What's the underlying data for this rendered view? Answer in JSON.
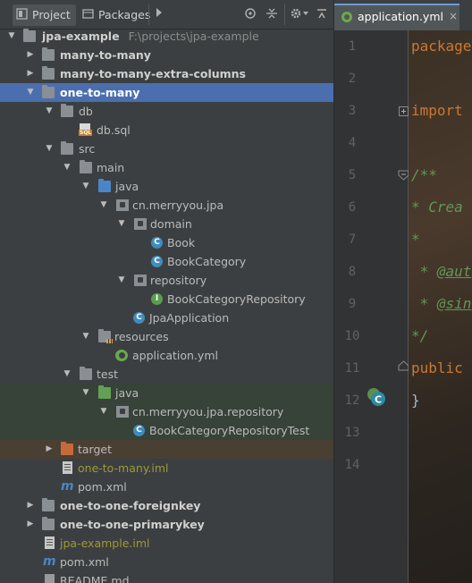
{
  "project_panel": {
    "tabs": [
      {
        "label": "Project",
        "active": true
      },
      {
        "label": "Packages",
        "active": false
      }
    ],
    "toolbar_icons": [
      "play-arrow-icon",
      "locate-target-icon",
      "collapse-all-icon",
      "settings-gear-icon",
      "hide-panel-icon"
    ]
  },
  "tree": {
    "rows": [
      {
        "label": "jpa-example",
        "hint": "F:\\projects\\jpa-example"
      },
      {
        "label": "many-to-many"
      },
      {
        "label": "many-to-many-extra-columns"
      },
      {
        "label": "one-to-many"
      },
      {
        "label": "db"
      },
      {
        "label": "db.sql"
      },
      {
        "label": "src"
      },
      {
        "label": "main"
      },
      {
        "label": "java"
      },
      {
        "label": "cn.merryyou.jpa"
      },
      {
        "label": "domain"
      },
      {
        "label": "Book"
      },
      {
        "label": "BookCategory"
      },
      {
        "label": "repository"
      },
      {
        "label": "BookCategoryRepository"
      },
      {
        "label": "JpaApplication"
      },
      {
        "label": "resources"
      },
      {
        "label": "application.yml"
      },
      {
        "label": "test"
      },
      {
        "label": "java"
      },
      {
        "label": "cn.merryyou.jpa.repository"
      },
      {
        "label": "BookCategoryRepositoryTest"
      },
      {
        "label": "target"
      },
      {
        "label": "one-to-many.iml"
      },
      {
        "label": "pom.xml"
      },
      {
        "label": "one-to-one-foreignkey"
      },
      {
        "label": "one-to-one-primarykey"
      },
      {
        "label": "jpa-example.iml"
      },
      {
        "label": "pom.xml"
      },
      {
        "label": "README.md"
      }
    ]
  },
  "editor": {
    "tab": {
      "label": "application.yml",
      "close": "×"
    },
    "line_numbers": [
      "1",
      "2",
      "3",
      "4",
      "5",
      "6",
      "7",
      "8",
      "9",
      "10",
      "11",
      "12",
      "13",
      "14"
    ],
    "code": {
      "line1": "package",
      "line3": "import",
      "line6": "/**",
      "line7": " * Crea",
      "line8": " *",
      "line9_prefix": " * ",
      "line9_tag": "@aut",
      "line10_prefix": " * ",
      "line10_tag": "@sin",
      "line11": " */",
      "line12": "public",
      "line13": "}"
    }
  },
  "colors": {
    "selection": "#4b6eaf",
    "keyword": "#cc7832",
    "comment": "#629755",
    "class_icon": "#3f8cbf",
    "interface_icon": "#5a9e4e",
    "source_folder": "#4a86c7",
    "test_folder": "#62a053",
    "excluded_folder": "#c46a3b",
    "iml_text": "#9e9a32"
  }
}
